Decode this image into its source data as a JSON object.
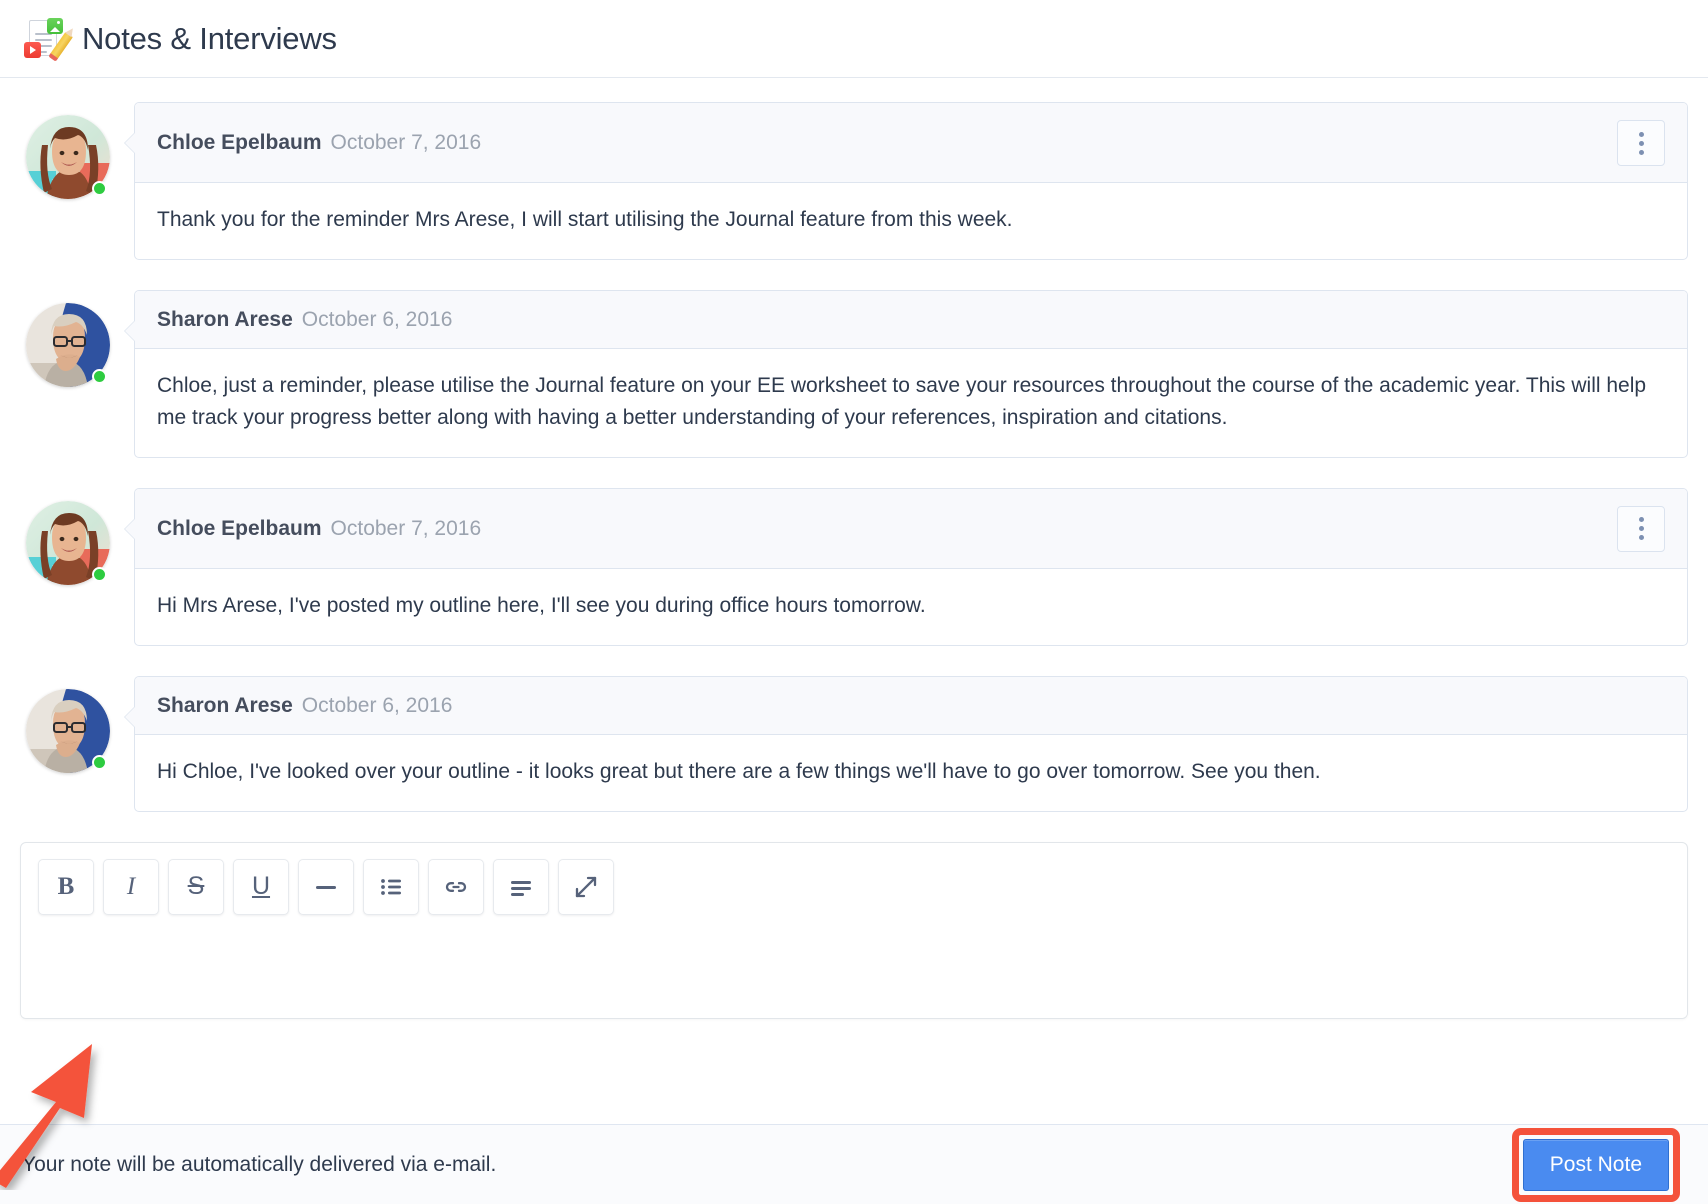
{
  "header": {
    "title": "Notes & Interviews",
    "icon": "notes-document-pencil-icon"
  },
  "messages": [
    {
      "author": "Chloe Epelbaum",
      "date": "October 7, 2016",
      "body": "Thank you for the reminder Mrs Arese, I will start utilising the Journal feature from this week.",
      "avatar": "chloe-avatar",
      "status": "online",
      "has_menu": true,
      "menu_icon": "kebab-menu-icon"
    },
    {
      "author": "Sharon Arese",
      "date": "October 6, 2016",
      "body": "Chloe, just a reminder, please utilise the Journal feature on your EE worksheet to save your resources throughout the course of the academic year. This will help me track your progress better along with having a better understanding of your references, inspiration and citations.",
      "avatar": "sharon-avatar",
      "status": "online",
      "has_menu": false,
      "menu_icon": ""
    },
    {
      "author": "Chloe Epelbaum",
      "date": "October 7, 2016",
      "body": "Hi Mrs Arese, I've posted my outline here, I'll see you during office hours tomorrow.",
      "avatar": "chloe-avatar",
      "status": "online",
      "has_menu": true,
      "menu_icon": "kebab-menu-icon"
    },
    {
      "author": "Sharon Arese",
      "date": "October 6, 2016",
      "body": "Hi Chloe, I've looked over your outline - it looks great but there are a few things we'll have to go over tomorrow. See you then.",
      "avatar": "sharon-avatar",
      "status": "online",
      "has_menu": false,
      "menu_icon": ""
    }
  ],
  "editor": {
    "content": "",
    "placeholder": "",
    "toolbar": [
      {
        "name": "bold",
        "label": "B",
        "icon": "bold-icon"
      },
      {
        "name": "italic",
        "label": "I",
        "icon": "italic-icon"
      },
      {
        "name": "strikethrough",
        "label": "S",
        "icon": "strikethrough-icon"
      },
      {
        "name": "underline",
        "label": "U",
        "icon": "underline-icon"
      },
      {
        "name": "horizontal-rule",
        "label": "",
        "icon": "horizontal-rule-icon"
      },
      {
        "name": "bullet-list",
        "label": "",
        "icon": "bullet-list-icon"
      },
      {
        "name": "link",
        "label": "",
        "icon": "link-icon"
      },
      {
        "name": "align",
        "label": "",
        "icon": "align-left-icon"
      },
      {
        "name": "expand",
        "label": "",
        "icon": "expand-arrows-icon"
      }
    ]
  },
  "footer": {
    "note": "Your note will be automatically delivered via e-mail.",
    "post_label": "Post Note"
  },
  "colors": {
    "accent_blue": "#4a8bf0",
    "annotation_red": "#f4523b",
    "online_green": "#2ecc40",
    "header_bg": "#f8f9fc",
    "border": "#dee5ef",
    "text": "#2e3a4d",
    "muted_text": "#9ba3af"
  },
  "annotations": {
    "arrow": "red-arrow-pointing-to-editor",
    "highlight": "red-box-around-post-note-button"
  }
}
